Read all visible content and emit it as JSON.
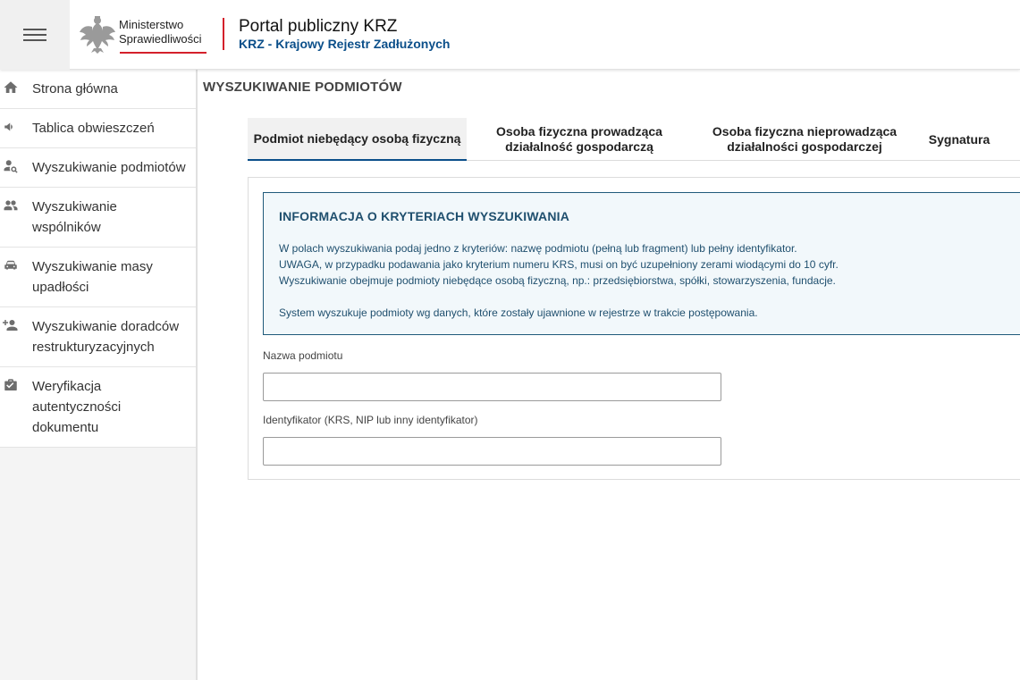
{
  "header": {
    "menu_icon": "hamburger-menu-icon",
    "logo_icon": "polish-eagle-emblem-icon",
    "ministry_line1": "Ministerstwo",
    "ministry_line2": "Sprawiedliwości",
    "portal_title": "Portal publiczny KRZ",
    "portal_subtitle": "KRZ - Krajowy Rejestr Zadłużonych",
    "accent_color": "#d4202b",
    "brand_color": "#0b4f8a"
  },
  "sidebar": {
    "items": [
      {
        "label": "Strona główna",
        "icon": "home-icon"
      },
      {
        "label": "Tablica obwieszczeń",
        "icon": "megaphone-icon"
      },
      {
        "label": "Wyszukiwanie podmiotów",
        "icon": "person-search-icon"
      },
      {
        "label": "Wyszukiwanie wspólników",
        "icon": "people-icon"
      },
      {
        "label": "Wyszukiwanie masy upadłości",
        "icon": "car-icon"
      },
      {
        "label": "Wyszukiwanie doradców restrukturyzacyjnych",
        "icon": "person-add-icon"
      },
      {
        "label": "Weryfikacja autentyczności dokumentu",
        "icon": "briefcase-check-icon"
      }
    ]
  },
  "main": {
    "page_title": "WYSZUKIWANIE PODMIOTÓW",
    "tabs": [
      {
        "label": "Podmiot niebędący osobą fizyczną",
        "active": true
      },
      {
        "label": "Osoba fizyczna prowadząca działalność gospodarczą",
        "active": false
      },
      {
        "label": "Osoba fizyczna nieprowadząca działalności gospodarczej",
        "active": false
      },
      {
        "label": "Sygnatura",
        "active": false
      }
    ],
    "info": {
      "title": "INFORMACJA O KRYTERIACH WYSZUKIWANIA",
      "line1": "W polach wyszukiwania podaj jedno z kryteriów: nazwę podmiotu (pełną lub fragment) lub pełny identyfikator.",
      "line2": "UWAGA, w przypadku podawania jako kryterium numeru KRS, musi on być uzupełniony zerami wiodącymi do 10 cyfr.",
      "line3": "Wyszukiwanie obejmuje podmioty niebędące osobą fizyczną, np.: przedsiębiorstwa, spółki, stowarzyszenia, fundacje.",
      "line4": "System wyszukuje podmioty wg danych, które zostały ujawnione w rejestrze w trakcie postępowania."
    },
    "fields": {
      "name_label": "Nazwa podmiotu",
      "name_value": "",
      "id_label": "Identyfikator (KRS, NIP lub inny identyfikator)",
      "id_value": ""
    }
  }
}
